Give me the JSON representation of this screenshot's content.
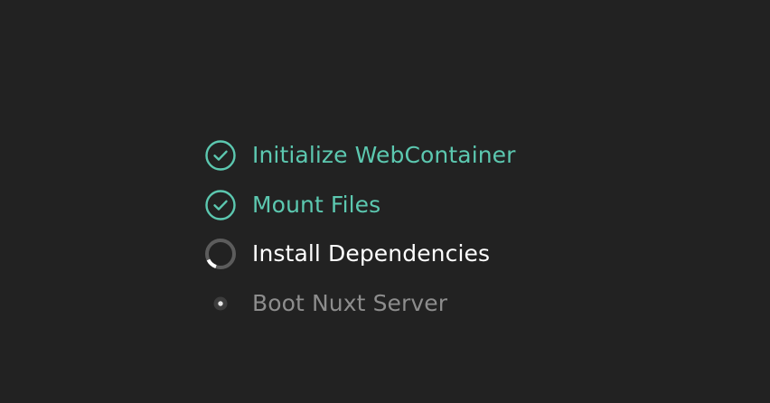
{
  "colors": {
    "background": "#222222",
    "done": "#5cc8b0",
    "active": "#ffffff",
    "pending": "#8d8d8d"
  },
  "steps": [
    {
      "label": "Initialize WebContainer",
      "status": "done",
      "icon": "check-circle-icon"
    },
    {
      "label": "Mount Files",
      "status": "done",
      "icon": "check-circle-icon"
    },
    {
      "label": "Install Dependencies",
      "status": "in-progress",
      "icon": "spinner-icon"
    },
    {
      "label": "Boot Nuxt Server",
      "status": "pending",
      "icon": "dot-icon"
    }
  ]
}
